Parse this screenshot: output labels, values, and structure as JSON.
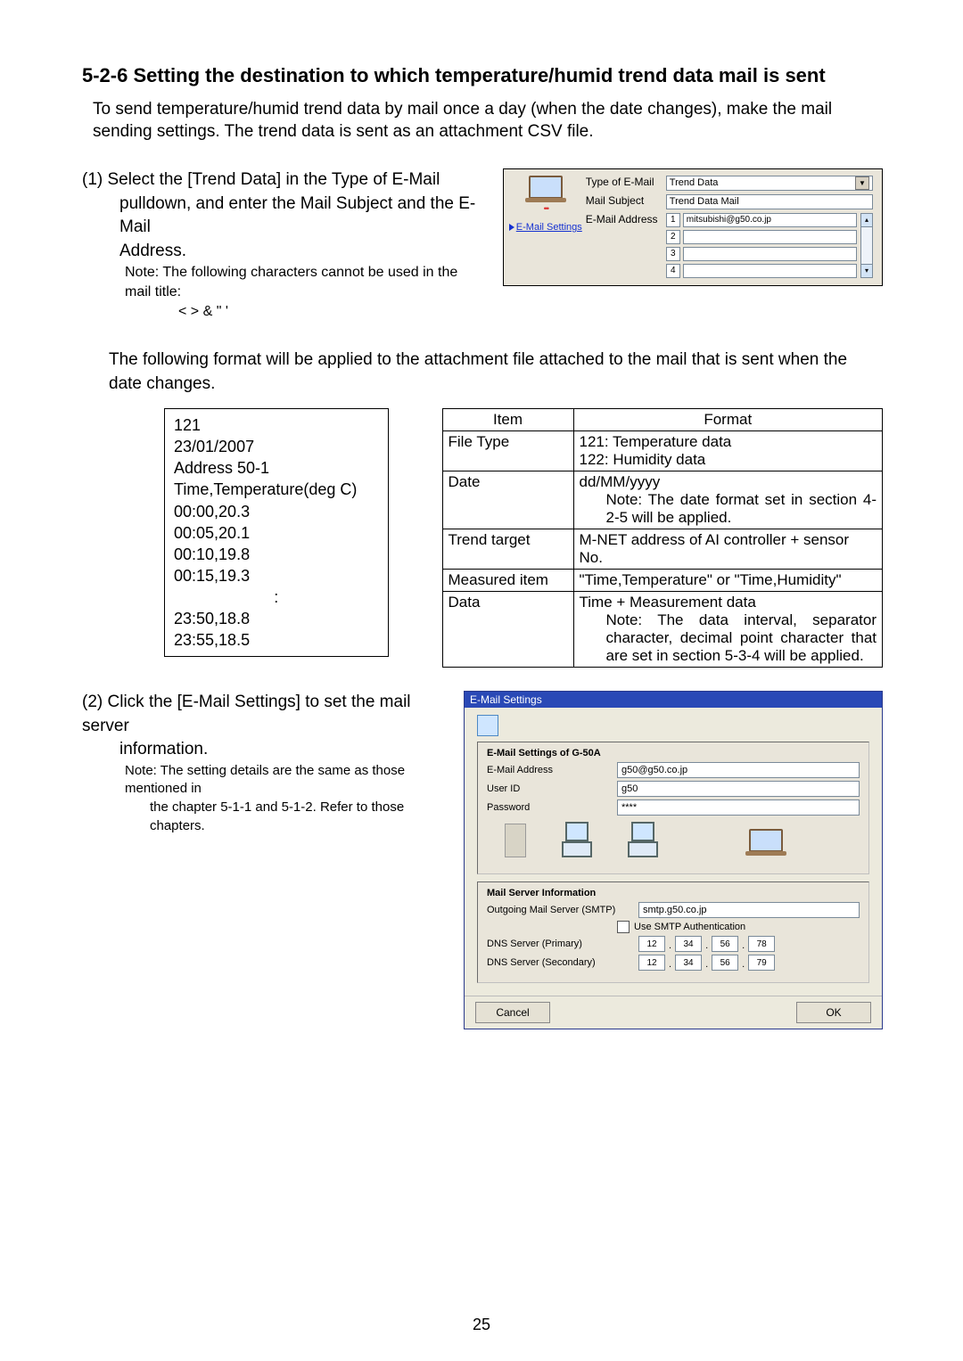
{
  "heading": "5-2-6 Setting the destination to which temperature/humid trend data mail is sent",
  "intro": "To send temperature/humid trend data by mail once a day (when the date changes), make the mail sending settings. The trend data is sent as an attachment CSV file.",
  "step1": {
    "text_a": "(1) Select the [Trend Data] in the Type of E-Mail",
    "text_b": "pulldown, and enter the Mail Subject and the E-Mail",
    "text_c": "Address.",
    "note1": "Note: The following characters cannot be used in the mail title:",
    "note2": "< > & \" '"
  },
  "panel1": {
    "link": "E-Mail Settings",
    "labels": {
      "type": "Type of E-Mail",
      "subject": "Mail Subject",
      "addr": "E-Mail Address"
    },
    "type_value": "Trend Data",
    "subject_value": "Trend Data Mail",
    "rows": [
      {
        "n": "1",
        "v": "mitsubishi@g50.co.jp"
      },
      {
        "n": "2",
        "v": ""
      },
      {
        "n": "3",
        "v": ""
      },
      {
        "n": "4",
        "v": ""
      }
    ]
  },
  "midtext": "The following format will be applied to the attachment file attached to the mail that is sent when the date changes.",
  "csv": {
    "l1": "121",
    "l2": "23/01/2007",
    "l3": "Address 50-1",
    "l4": "Time,Temperature(deg C)",
    "l5": "00:00,20.3",
    "l6": "00:05,20.1",
    "l7": "00:10,19.8",
    "l8": "00:15,19.3",
    "l9": ":",
    "l10": "23:50,18.8",
    "l11": "23:55,18.5"
  },
  "fmt": {
    "h1": "Item",
    "h2": "Format",
    "r1a": "File Type",
    "r1b": "121: Temperature data",
    "r1c": "122: Humidity data",
    "r2a": "Date",
    "r2b": "dd/MM/yyyy",
    "r2c": "Note: The date format set in section 4-2-5 will be applied.",
    "r3a": "Trend target",
    "r3b": "M-NET address of AI controller + sensor No.",
    "r4a": "Measured item",
    "r4b": "\"Time,Temperature\" or \"Time,Humidity\"",
    "r5a": "Data",
    "r5b": "Time + Measurement data",
    "r5c": "Note: The data interval, separator character, decimal point character that are set in section 5-3-4 will be applied."
  },
  "step2": {
    "text_a": "(2) Click the [E-Mail Settings] to set the mail server",
    "text_b": "information.",
    "note1": "Note: The setting details are the same as those mentioned in",
    "note2": "the chapter 5-1-1 and 5-1-2. Refer to those chapters."
  },
  "dlg": {
    "title": "E-Mail Settings",
    "g1_hdr": "E-Mail Settings of G-50A",
    "email_l": "E-Mail Address",
    "email_v": "g50@g50.co.jp",
    "user_l": "User ID",
    "user_v": "g50",
    "pwd_l": "Password",
    "pwd_v": "****",
    "g2_hdr": "Mail Server Information",
    "smtp_l": "Outgoing Mail Server (SMTP)",
    "smtp_v": "smtp.g50.co.jp",
    "auth": "Use SMTP Authentication",
    "dns1_l": "DNS Server (Primary)",
    "dns1": [
      "12",
      "34",
      "56",
      "78"
    ],
    "dns2_l": "DNS Server (Secondary)",
    "dns2": [
      "12",
      "34",
      "56",
      "79"
    ],
    "cancel": "Cancel",
    "ok": "OK"
  },
  "page_number": "25"
}
